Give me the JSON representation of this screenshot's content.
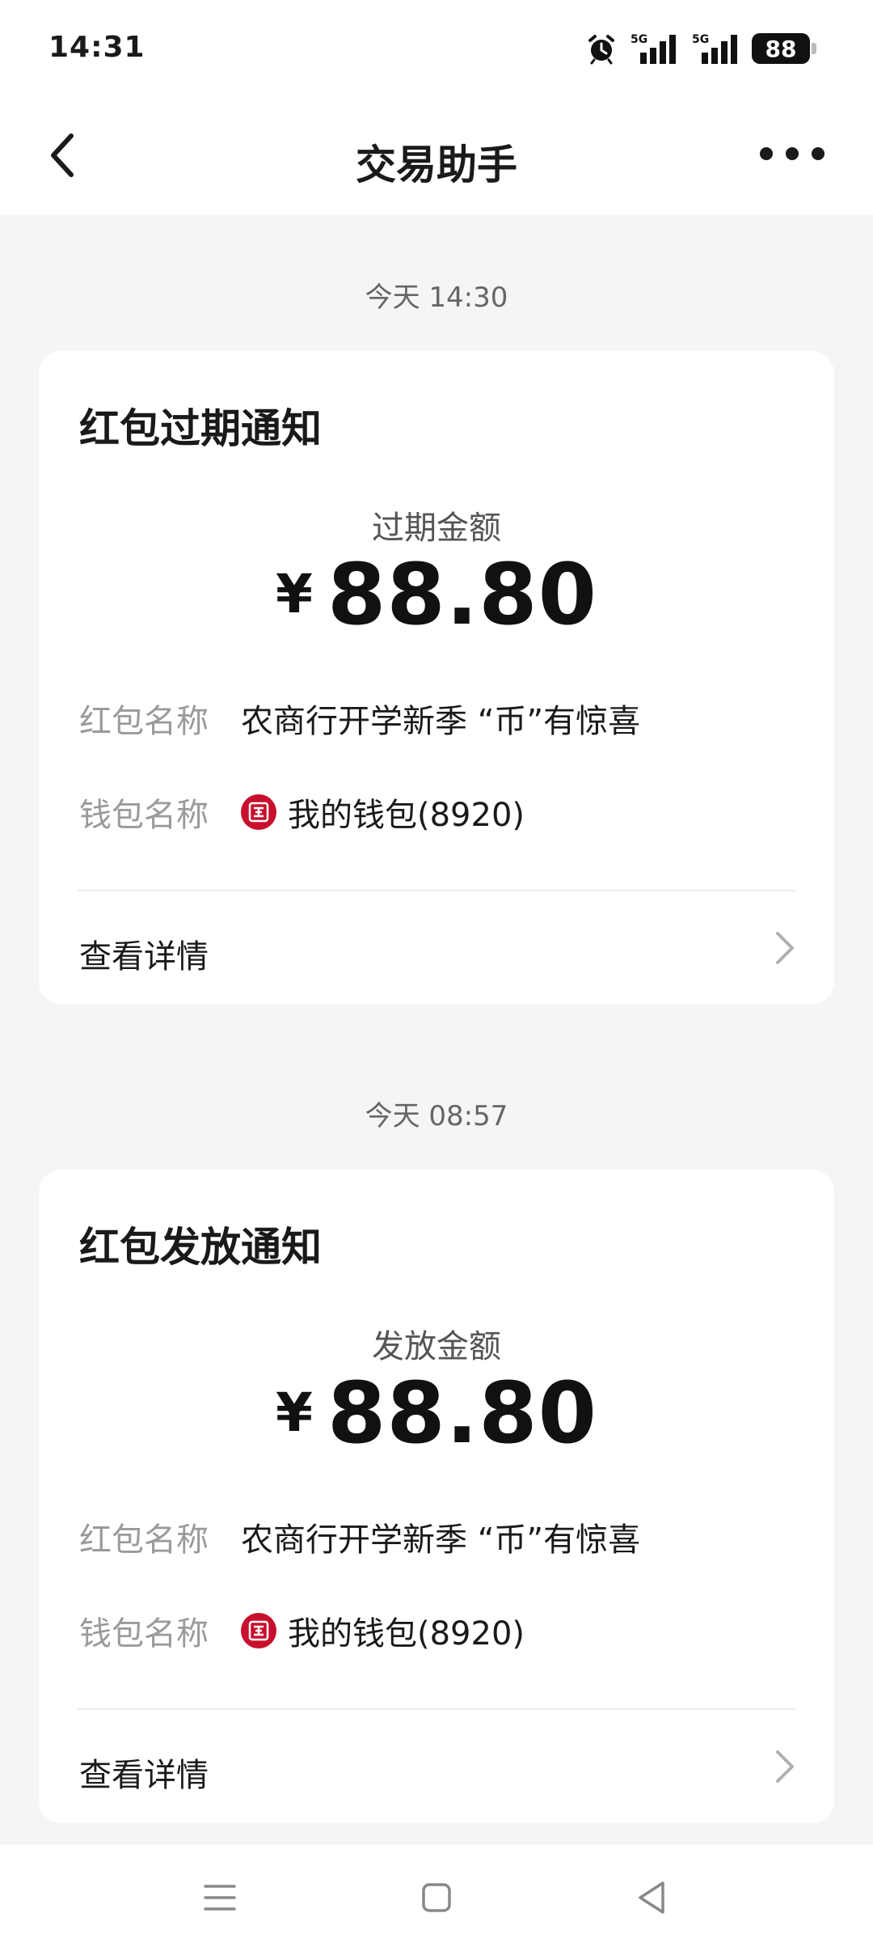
{
  "status_bar": {
    "time": "14:31",
    "network_1": "5G",
    "network_2": "5G",
    "battery": "88"
  },
  "nav": {
    "title": "交易助手"
  },
  "messages": [
    {
      "timestamp": "今天 14:30",
      "title": "红包过期通知",
      "amount_label": "过期金额",
      "currency": "¥",
      "amount": "88.80",
      "envelope_label": "红包名称",
      "envelope_name": "农商行开学新季 “币”有惊喜",
      "wallet_label": "钱包名称",
      "wallet_name": "我的钱包(8920)",
      "details_label": "查看详情"
    },
    {
      "timestamp": "今天 08:57",
      "title": "红包发放通知",
      "amount_label": "发放金额",
      "currency": "¥",
      "amount": "88.80",
      "envelope_label": "红包名称",
      "envelope_name": "农商行开学新季 “币”有惊喜",
      "wallet_label": "钱包名称",
      "wallet_name": "我的钱包(8920)",
      "details_label": "查看详情"
    }
  ],
  "icons": {
    "back": "back-arrow-icon",
    "more": "more-dots-icon",
    "alarm": "alarm-clock-icon",
    "signal": "signal-bars-icon",
    "bank": "bank-logo-icon",
    "chevron": "chevron-right-icon",
    "menu": "menu-icon",
    "home": "home-square-icon",
    "recent": "back-triangle-icon"
  },
  "colors": {
    "accent": "#c8102e",
    "background": "#f4f5f7",
    "card": "#ffffff"
  }
}
